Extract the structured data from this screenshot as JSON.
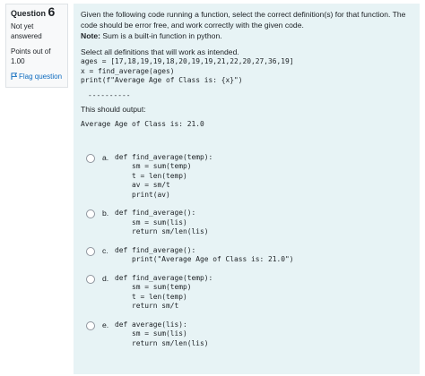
{
  "sidebar": {
    "question_label": "Question",
    "question_number": "6",
    "status": "Not yet answered",
    "points": "Points out of 1.00",
    "flag_label": "Flag question"
  },
  "question": {
    "intro": "Given the following code running a function, select the correct definition(s) for that function. The code should be error free, and work correctly with the given code.",
    "note_label": "Note:",
    "note_text": " Sum is a built-in function in python.",
    "instruction": "Select all definitions that will work as intended.",
    "code": "ages = [17,18,19,19,18,20,19,19,21,22,20,27,36,19]\nx = find_average(ages)\nprint(f\"Average Age of Class is: {x}\")",
    "separator": "----------",
    "output_intro": "This should output:",
    "output": "Average Age of Class is: 21.0"
  },
  "answers": [
    {
      "letter": "a.",
      "code": "def find_average(temp):\n    sm = sum(temp)\n    t = len(temp)\n    av = sm/t\n    print(av)"
    },
    {
      "letter": "b.",
      "code": "def find_average():\n    sm = sum(lis)\n    return sm/len(lis)"
    },
    {
      "letter": "c.",
      "code": "def find_average():\n    print(\"Average Age of Class is: 21.0\")"
    },
    {
      "letter": "d.",
      "code": "def find_average(temp):\n    sm = sum(temp)\n    t = len(temp)\n    return sm/t"
    },
    {
      "letter": "e.",
      "code": "def average(lis):\n    sm = sum(lis)\n    return sm/len(lis)"
    }
  ]
}
